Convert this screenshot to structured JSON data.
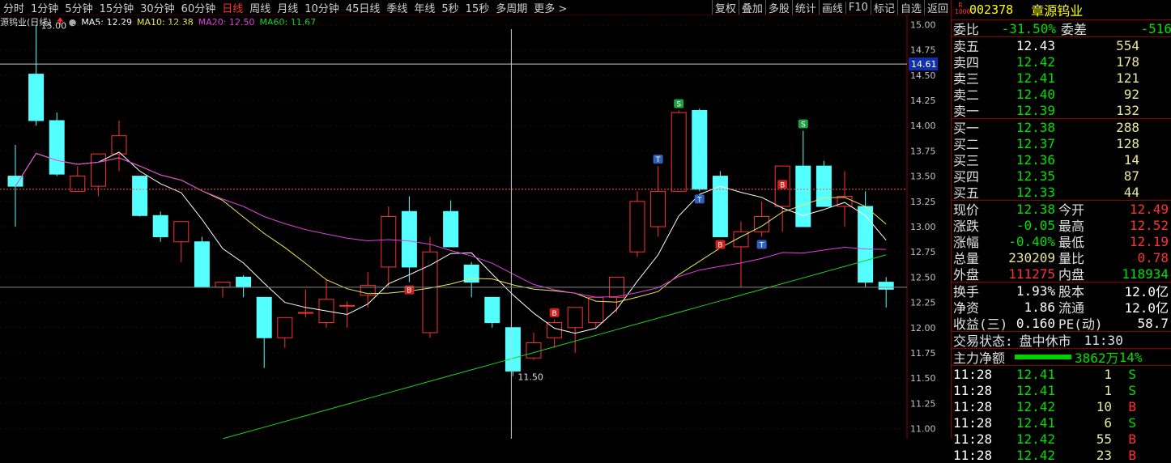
{
  "toolbar": {
    "periods": [
      "分时",
      "1分钟",
      "5分钟",
      "15分钟",
      "30分钟",
      "60分钟",
      "日线",
      "周线",
      "月线",
      "10分钟",
      "45日线",
      "季线",
      "年线",
      "5秒",
      "15秒",
      "多周期",
      "更多 >"
    ],
    "active": "日线",
    "tools": [
      "复权",
      "叠加",
      "多股",
      "统计",
      "画线",
      "F10",
      "标记",
      "自选",
      "返回"
    ]
  },
  "legend": {
    "title": "源钨业(日线)",
    "ma5": "MA5: 12.29",
    "ma10": "MA10: 12.38",
    "ma20": "MA20: 12.50",
    "ma60": "MA60: 11.67"
  },
  "colors": {
    "up": "#ff3232",
    "down": "#54ffff",
    "ma5": "#ffffff",
    "ma10": "#e8e85a",
    "ma20": "#e040e0",
    "ma60": "#20d020",
    "axis": "#8b0000",
    "cross": "#cccccc"
  },
  "chart_data": {
    "type": "candlestick",
    "ylim": [
      10.9,
      15.1
    ],
    "yticks": [
      "15.00",
      "14.75",
      "14.50",
      "14.25",
      "14.00",
      "13.75",
      "13.50",
      "13.25",
      "13.00",
      "12.75",
      "12.50",
      "12.25",
      "12.00",
      "11.75",
      "11.50",
      "11.25",
      "11.00"
    ],
    "cursor_price": "14.61",
    "high_label": "15.00",
    "low_label": "11.50",
    "candles": [
      [
        13.5,
        13.81,
        13.0,
        13.4
      ],
      [
        14.51,
        15.0,
        14.0,
        14.05
      ],
      [
        14.05,
        14.13,
        13.5,
        13.52
      ],
      [
        13.35,
        13.6,
        13.35,
        13.5
      ],
      [
        13.4,
        13.7,
        13.3,
        13.72
      ],
      [
        13.72,
        14.05,
        13.55,
        13.9
      ],
      [
        13.5,
        13.5,
        13.1,
        13.11
      ],
      [
        13.11,
        13.15,
        12.85,
        12.9
      ],
      [
        12.85,
        13.05,
        12.65,
        13.05
      ],
      [
        12.85,
        12.9,
        12.4,
        12.4
      ],
      [
        12.4,
        12.45,
        12.3,
        12.45
      ],
      [
        12.5,
        12.52,
        12.3,
        12.4
      ],
      [
        12.3,
        12.3,
        11.6,
        11.9
      ],
      [
        11.9,
        12.1,
        11.8,
        12.1
      ],
      [
        12.15,
        12.38,
        12.1,
        12.15
      ],
      [
        12.05,
        12.48,
        12.0,
        12.28
      ],
      [
        12.22,
        12.26,
        12.0,
        12.22
      ],
      [
        12.32,
        12.55,
        12.2,
        12.42
      ],
      [
        12.6,
        13.2,
        12.4,
        13.1
      ],
      [
        13.15,
        13.3,
        12.45,
        12.6
      ],
      [
        11.95,
        12.9,
        11.9,
        12.75
      ],
      [
        13.15,
        13.26,
        12.8,
        12.8
      ],
      [
        12.62,
        12.65,
        12.3,
        12.45
      ],
      [
        12.3,
        12.3,
        12.0,
        12.05
      ],
      [
        12.0,
        12.0,
        11.52,
        11.57
      ],
      [
        11.7,
        11.95,
        11.68,
        11.85
      ],
      [
        11.9,
        12.08,
        11.8,
        12.05
      ],
      [
        12.0,
        12.15,
        11.75,
        12.2
      ],
      [
        12.05,
        12.3,
        12.0,
        12.3
      ],
      [
        12.3,
        12.5,
        12.15,
        12.5
      ],
      [
        12.75,
        13.35,
        12.7,
        13.25
      ],
      [
        13.0,
        13.6,
        12.9,
        13.35
      ],
      [
        13.35,
        14.15,
        13.35,
        14.13
      ],
      [
        14.15,
        14.17,
        13.35,
        13.37
      ],
      [
        13.5,
        13.55,
        12.9,
        12.9
      ],
      [
        12.8,
        13.05,
        12.4,
        12.95
      ],
      [
        12.95,
        13.25,
        12.9,
        13.1
      ],
      [
        13.2,
        13.35,
        12.95,
        13.6
      ],
      [
        13.6,
        13.95,
        13.1,
        13.0
      ],
      [
        13.6,
        13.65,
        13.2,
        13.2
      ],
      [
        13.2,
        13.55,
        13.0,
        13.3
      ],
      [
        13.2,
        13.35,
        12.4,
        12.45
      ],
      [
        12.45,
        12.5,
        12.2,
        12.38
      ]
    ],
    "markers": [
      {
        "i": 19,
        "t": "B",
        "pos": "below"
      },
      {
        "i": 26,
        "t": "B",
        "pos": "above"
      },
      {
        "i": 31,
        "t": "T",
        "pos": "above"
      },
      {
        "i": 32,
        "t": "S",
        "pos": "above"
      },
      {
        "i": 33,
        "t": "T",
        "pos": "below"
      },
      {
        "i": 34,
        "t": "B",
        "pos": "below"
      },
      {
        "i": 36,
        "t": "T",
        "pos": "below"
      },
      {
        "i": 37,
        "t": "B",
        "pos": "above"
      },
      {
        "i": 38,
        "t": "S",
        "pos": "above"
      }
    ]
  },
  "quote": {
    "code": "002378",
    "name": "章源钨业",
    "weibi": {
      "label": "委比",
      "value": "-31.50%",
      "label2": "委差",
      "value2": "-516"
    },
    "sell": [
      [
        "卖五",
        "12.43",
        "554"
      ],
      [
        "卖四",
        "12.42",
        "178"
      ],
      [
        "卖三",
        "12.41",
        "121"
      ],
      [
        "卖二",
        "12.40",
        "92"
      ],
      [
        "卖一",
        "12.39",
        "132"
      ]
    ],
    "buy": [
      [
        "买一",
        "12.38",
        "288"
      ],
      [
        "买二",
        "12.37",
        "128"
      ],
      [
        "买三",
        "12.36",
        "14"
      ],
      [
        "买四",
        "12.35",
        "87"
      ],
      [
        "买五",
        "12.33",
        "44"
      ]
    ],
    "stats": [
      [
        "现价",
        "12.38",
        "今开",
        "12.49"
      ],
      [
        "涨跌",
        "-0.05",
        "最高",
        "12.52"
      ],
      [
        "涨幅",
        "-0.40%",
        "最低",
        "12.19"
      ],
      [
        "总量",
        "230209",
        "量比",
        "0.78"
      ],
      [
        "外盘",
        "111275",
        "内盘",
        "118934"
      ]
    ],
    "stats2": [
      [
        "换手",
        "1.93%",
        "股本",
        "12.0亿"
      ],
      [
        "净资",
        "1.86",
        "流通",
        "12.0亿"
      ],
      [
        "收益(三)",
        "0.160",
        "PE(动)",
        "58.7"
      ]
    ],
    "status": {
      "label": "交易状态:",
      "value": "盘中休市",
      "time": "11:30"
    },
    "mainflow": {
      "label": "主力净额",
      "value": "3862万",
      "pct": "14%"
    },
    "ticks": [
      [
        "11:28",
        "12.41",
        "1",
        "S"
      ],
      [
        "11:28",
        "12.41",
        "1",
        "S"
      ],
      [
        "11:28",
        "12.42",
        "10",
        "B"
      ],
      [
        "11:28",
        "12.41",
        "6",
        "S"
      ],
      [
        "11:28",
        "12.42",
        "55",
        "B"
      ],
      [
        "11:28",
        "12.42",
        "23",
        "B"
      ]
    ]
  }
}
